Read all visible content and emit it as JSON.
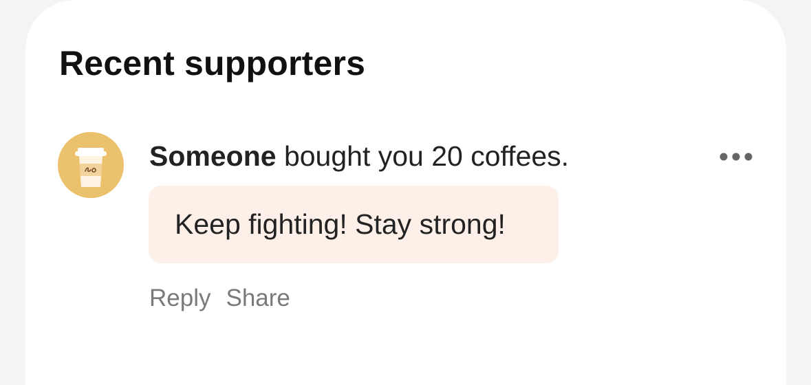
{
  "section": {
    "title": "Recent supporters"
  },
  "supporter": {
    "avatar_icon": "coffee-cup-icon",
    "avatar_bg": "#ecc16d",
    "name": "Someone",
    "action_text": " bought you 20 coffees.",
    "message": "Keep fighting! Stay strong!",
    "message_bg": "#fdf0e8",
    "more_icon": "more-options-icon",
    "reply_label": "Reply",
    "share_label": "Share"
  }
}
